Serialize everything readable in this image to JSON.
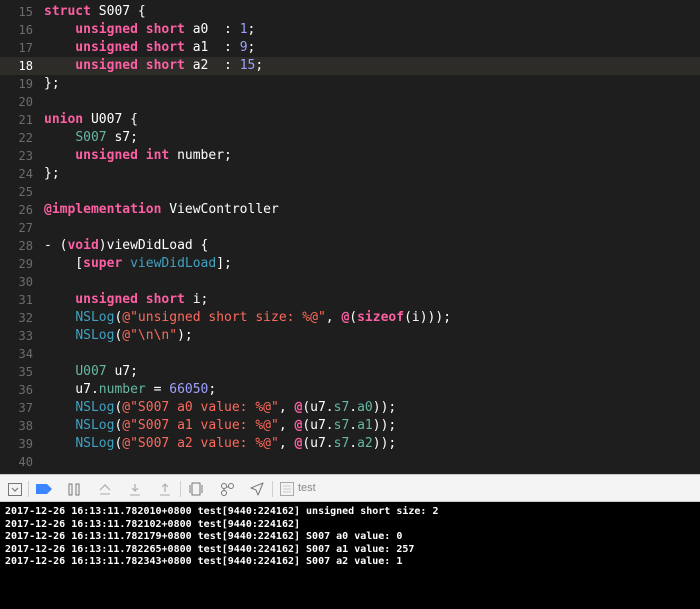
{
  "editor": {
    "current_line": "18",
    "lines": [
      {
        "num": "15",
        "tokens": [
          {
            "t": "struct ",
            "c": "kw"
          },
          {
            "t": "S007 {",
            "c": "plain"
          }
        ]
      },
      {
        "num": "16",
        "tokens": [
          {
            "t": "    unsigned short ",
            "c": "kw"
          },
          {
            "t": "a0  : ",
            "c": "plain"
          },
          {
            "t": "1",
            "c": "nm"
          },
          {
            "t": ";",
            "c": "plain"
          }
        ]
      },
      {
        "num": "17",
        "tokens": [
          {
            "t": "    unsigned short ",
            "c": "kw"
          },
          {
            "t": "a1  : ",
            "c": "plain"
          },
          {
            "t": "9",
            "c": "nm"
          },
          {
            "t": ";",
            "c": "plain"
          }
        ]
      },
      {
        "num": "18",
        "tokens": [
          {
            "t": "    unsigned short ",
            "c": "kw"
          },
          {
            "t": "a2  : ",
            "c": "plain"
          },
          {
            "t": "15",
            "c": "nm"
          },
          {
            "t": ";",
            "c": "plain"
          }
        ]
      },
      {
        "num": "19",
        "tokens": [
          {
            "t": "};",
            "c": "plain"
          }
        ]
      },
      {
        "num": "20",
        "tokens": []
      },
      {
        "num": "21",
        "tokens": [
          {
            "t": "union ",
            "c": "kw"
          },
          {
            "t": "U007 {",
            "c": "plain"
          }
        ]
      },
      {
        "num": "22",
        "tokens": [
          {
            "t": "    ",
            "c": "plain"
          },
          {
            "t": "S007",
            "c": "type"
          },
          {
            "t": " s7;",
            "c": "plain"
          }
        ]
      },
      {
        "num": "23",
        "tokens": [
          {
            "t": "    unsigned int ",
            "c": "kw"
          },
          {
            "t": "number;",
            "c": "plain"
          }
        ]
      },
      {
        "num": "24",
        "tokens": [
          {
            "t": "};",
            "c": "plain"
          }
        ]
      },
      {
        "num": "25",
        "tokens": []
      },
      {
        "num": "26",
        "tokens": [
          {
            "t": "@implementation ",
            "c": "kw"
          },
          {
            "t": "ViewController",
            "c": "plain"
          }
        ]
      },
      {
        "num": "27",
        "tokens": []
      },
      {
        "num": "28",
        "tokens": [
          {
            "t": "- (",
            "c": "plain"
          },
          {
            "t": "void",
            "c": "kw"
          },
          {
            "t": ")viewDidLoad {",
            "c": "plain"
          }
        ]
      },
      {
        "num": "29",
        "tokens": [
          {
            "t": "    [",
            "c": "plain"
          },
          {
            "t": "super ",
            "c": "kw"
          },
          {
            "t": "viewDidLoad",
            "c": "fn"
          },
          {
            "t": "];",
            "c": "plain"
          }
        ]
      },
      {
        "num": "30",
        "tokens": []
      },
      {
        "num": "31",
        "tokens": [
          {
            "t": "    unsigned short ",
            "c": "kw"
          },
          {
            "t": "i;",
            "c": "plain"
          }
        ]
      },
      {
        "num": "32",
        "tokens": [
          {
            "t": "    ",
            "c": "plain"
          },
          {
            "t": "NSLog",
            "c": "fn"
          },
          {
            "t": "(",
            "c": "plain"
          },
          {
            "t": "@\"unsigned short size: %@\"",
            "c": "str"
          },
          {
            "t": ", ",
            "c": "plain"
          },
          {
            "t": "@",
            "c": "kw"
          },
          {
            "t": "(",
            "c": "plain"
          },
          {
            "t": "sizeof",
            "c": "kw"
          },
          {
            "t": "(i)));",
            "c": "plain"
          }
        ]
      },
      {
        "num": "33",
        "tokens": [
          {
            "t": "    ",
            "c": "plain"
          },
          {
            "t": "NSLog",
            "c": "fn"
          },
          {
            "t": "(",
            "c": "plain"
          },
          {
            "t": "@\"\\n\\n\"",
            "c": "str"
          },
          {
            "t": ");",
            "c": "plain"
          }
        ]
      },
      {
        "num": "34",
        "tokens": []
      },
      {
        "num": "35",
        "tokens": [
          {
            "t": "    ",
            "c": "plain"
          },
          {
            "t": "U007",
            "c": "type"
          },
          {
            "t": " u7;",
            "c": "plain"
          }
        ]
      },
      {
        "num": "36",
        "tokens": [
          {
            "t": "    u7.",
            "c": "plain"
          },
          {
            "t": "number",
            "c": "prop"
          },
          {
            "t": " = ",
            "c": "plain"
          },
          {
            "t": "66050",
            "c": "nm"
          },
          {
            "t": ";",
            "c": "plain"
          }
        ]
      },
      {
        "num": "37",
        "tokens": [
          {
            "t": "    ",
            "c": "plain"
          },
          {
            "t": "NSLog",
            "c": "fn"
          },
          {
            "t": "(",
            "c": "plain"
          },
          {
            "t": "@\"S007 a0 value: %@\"",
            "c": "str"
          },
          {
            "t": ", ",
            "c": "plain"
          },
          {
            "t": "@",
            "c": "kw"
          },
          {
            "t": "(u7.",
            "c": "plain"
          },
          {
            "t": "s7",
            "c": "prop"
          },
          {
            "t": ".",
            "c": "plain"
          },
          {
            "t": "a0",
            "c": "prop"
          },
          {
            "t": "));",
            "c": "plain"
          }
        ]
      },
      {
        "num": "38",
        "tokens": [
          {
            "t": "    ",
            "c": "plain"
          },
          {
            "t": "NSLog",
            "c": "fn"
          },
          {
            "t": "(",
            "c": "plain"
          },
          {
            "t": "@\"S007 a1 value: %@\"",
            "c": "str"
          },
          {
            "t": ", ",
            "c": "plain"
          },
          {
            "t": "@",
            "c": "kw"
          },
          {
            "t": "(u7.",
            "c": "plain"
          },
          {
            "t": "s7",
            "c": "prop"
          },
          {
            "t": ".",
            "c": "plain"
          },
          {
            "t": "a1",
            "c": "prop"
          },
          {
            "t": "));",
            "c": "plain"
          }
        ]
      },
      {
        "num": "39",
        "tokens": [
          {
            "t": "    ",
            "c": "plain"
          },
          {
            "t": "NSLog",
            "c": "fn"
          },
          {
            "t": "(",
            "c": "plain"
          },
          {
            "t": "@\"S007 a2 value: %@\"",
            "c": "str"
          },
          {
            "t": ", ",
            "c": "plain"
          },
          {
            "t": "@",
            "c": "kw"
          },
          {
            "t": "(u7.",
            "c": "plain"
          },
          {
            "t": "s7",
            "c": "prop"
          },
          {
            "t": ".",
            "c": "plain"
          },
          {
            "t": "a2",
            "c": "prop"
          },
          {
            "t": "));",
            "c": "plain"
          }
        ]
      },
      {
        "num": "40",
        "tokens": []
      }
    ]
  },
  "debug_bar": {
    "process_label": "test",
    "icons": [
      "hide-debug-area-icon",
      "breakpoints-toggle-icon",
      "pause-icon",
      "step-over-icon",
      "step-into-icon",
      "step-out-icon",
      "view-hierarchy-icon",
      "memory-graph-icon",
      "simulate-location-icon",
      "process-icon"
    ]
  },
  "console": {
    "lines": [
      "2017-12-26 16:13:11.782010+0800 test[9440:224162] unsigned short size: 2",
      "2017-12-26 16:13:11.782102+0800 test[9440:224162]",
      "2017-12-26 16:13:11.782179+0800 test[9440:224162] S007 a0 value: 0",
      "2017-12-26 16:13:11.782265+0800 test[9440:224162] S007 a1 value: 257",
      "2017-12-26 16:13:11.782343+0800 test[9440:224162] S007 a2 value: 1"
    ]
  },
  "colors": {
    "editor_bg": "#1e1e1e",
    "current_line_bg": "#2e2c29",
    "keyword": "#fc5fa3",
    "string": "#fc6a5d",
    "number": "#9ea0ff",
    "function": "#41a1c0",
    "type": "#67b7a4",
    "breakpoint_blue": "#3d84ff"
  }
}
